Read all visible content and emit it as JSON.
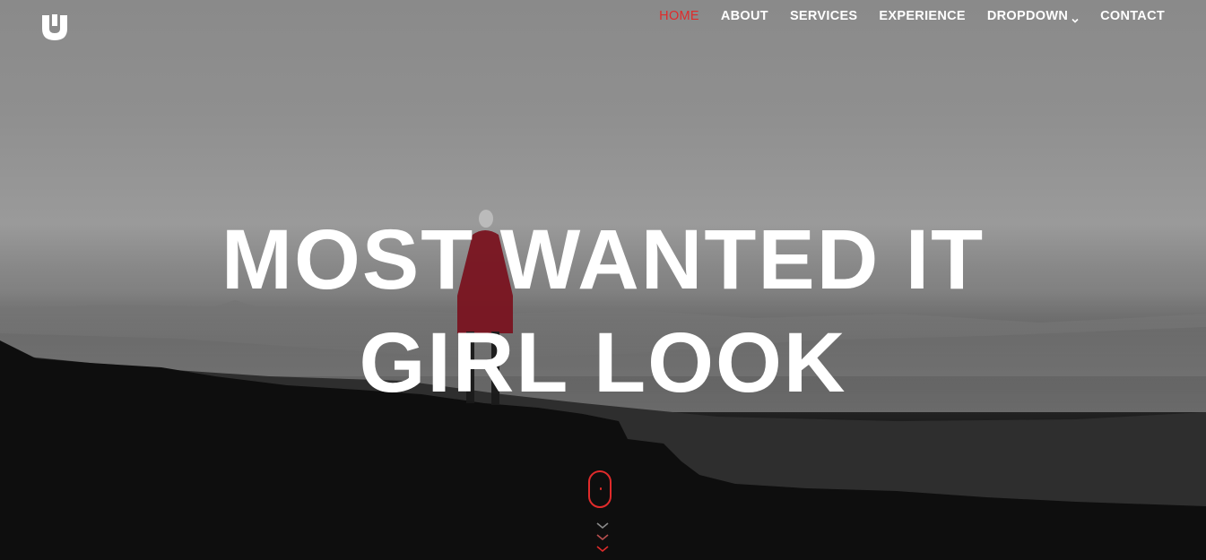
{
  "brand": {
    "logo_icon": "u-logo-icon"
  },
  "nav": {
    "items": [
      {
        "label": "HOME",
        "active": true
      },
      {
        "label": "ABOUT",
        "active": false
      },
      {
        "label": "SERVICES",
        "active": false
      },
      {
        "label": "EXPERIENCE",
        "active": false
      },
      {
        "label": "DROPDOWN",
        "active": false,
        "icon": "chevron-down-icon"
      },
      {
        "label": "CONTACT",
        "active": false
      }
    ]
  },
  "hero": {
    "headline_line1": "MOST WANTED IT",
    "headline_line2": "GIRL LOOK",
    "scroll_icon": "mouse-scroll-icon",
    "scroll_arrows_icon": "chevron-down-arrows-icon"
  },
  "colors": {
    "accent": "#e02b2b",
    "text": "#ffffff"
  }
}
